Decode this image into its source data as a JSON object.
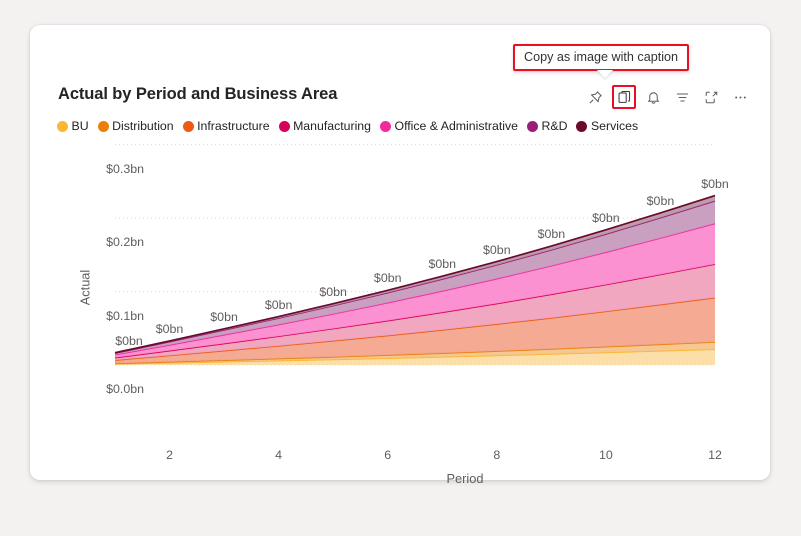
{
  "card": {
    "title": "Actual by Period and Business Area"
  },
  "tooltip": {
    "text": "Copy as image with caption"
  },
  "toolbar": {
    "items": [
      {
        "name": "pin-icon",
        "label": "Pin",
        "selected": false
      },
      {
        "name": "copy-icon",
        "label": "Copy as image with caption",
        "selected": true
      },
      {
        "name": "bell-icon",
        "label": "Alerts",
        "selected": false
      },
      {
        "name": "filter-icon",
        "label": "Filters",
        "selected": false
      },
      {
        "name": "focus-mode-icon",
        "label": "Focus mode",
        "selected": false
      },
      {
        "name": "more-options-icon",
        "label": "More options",
        "selected": false
      }
    ],
    "selection_color": "#e81123"
  },
  "chart_data": {
    "type": "area",
    "stacked": true,
    "title": "Actual by Period and Business Area",
    "xlabel": "Period",
    "ylabel": "Actual",
    "xlim": [
      1,
      12
    ],
    "xticks": [
      2,
      4,
      6,
      8,
      10,
      12
    ],
    "xtick_labels": [
      "2",
      "4",
      "6",
      "8",
      "10",
      "12"
    ],
    "ylim": [
      0,
      0.32
    ],
    "yticks": [
      0.0,
      0.1,
      0.2,
      0.3
    ],
    "ytick_labels": [
      "$0.0bn",
      "$0.1bn",
      "$0.2bn",
      "$0.3bn"
    ],
    "grid": true,
    "legend_position": "top-left",
    "x": [
      1,
      2,
      3,
      4,
      5,
      6,
      7,
      8,
      9,
      10,
      11,
      12
    ],
    "data_labels": [
      "$0bn",
      "$0bn",
      "$0bn",
      "$0bn",
      "$0bn",
      "$0bn",
      "$0bn",
      "$0bn",
      "$0bn",
      "$0bn",
      "$0bn",
      "$0bn"
    ],
    "series": [
      {
        "name": "BU",
        "color": "#FBB731",
        "fill": "#FCDCA4",
        "values": [
          0.0016,
          0.0031,
          0.0046,
          0.0061,
          0.0077,
          0.0094,
          0.0112,
          0.0131,
          0.0151,
          0.0172,
          0.0194,
          0.0216
        ]
      },
      {
        "name": "Distribution",
        "color": "#E8810C",
        "fill": "#F7C48A",
        "values": [
          0.0007,
          0.0013,
          0.002,
          0.0027,
          0.0034,
          0.0042,
          0.005,
          0.0059,
          0.0068,
          0.0078,
          0.0088,
          0.0098
        ]
      },
      {
        "name": "Infrastructure",
        "color": "#EE5A13",
        "fill": "#F3A58D",
        "values": [
          0.0044,
          0.0086,
          0.0129,
          0.0173,
          0.0219,
          0.0266,
          0.0316,
          0.0368,
          0.0423,
          0.0481,
          0.0541,
          0.0603
        ]
      },
      {
        "name": "Manufacturing",
        "color": "#D9005B",
        "fill": "#F0A2BC",
        "values": [
          0.0033,
          0.0065,
          0.0098,
          0.0131,
          0.0166,
          0.0202,
          0.024,
          0.0279,
          0.0321,
          0.0364,
          0.041,
          0.0457
        ]
      },
      {
        "name": "Office & Administrative",
        "color": "#F02A9C",
        "fill": "#FB8BCD",
        "values": [
          0.004,
          0.0079,
          0.0119,
          0.0159,
          0.0201,
          0.0245,
          0.0291,
          0.0339,
          0.0389,
          0.0442,
          0.0497,
          0.0554
        ]
      },
      {
        "name": "R&D",
        "color": "#9B1D7A",
        "fill": "#C79BBE",
        "values": [
          0.0022,
          0.0044,
          0.0066,
          0.0088,
          0.0112,
          0.0136,
          0.0162,
          0.0188,
          0.0216,
          0.0246,
          0.0276,
          0.0308
        ]
      },
      {
        "name": "Services",
        "color": "#6B0A2E",
        "fill": "#B898A4",
        "values": [
          0.0005,
          0.001,
          0.0015,
          0.0021,
          0.0026,
          0.0032,
          0.0038,
          0.0044,
          0.0051,
          0.0058,
          0.0065,
          0.0072
        ]
      }
    ]
  }
}
